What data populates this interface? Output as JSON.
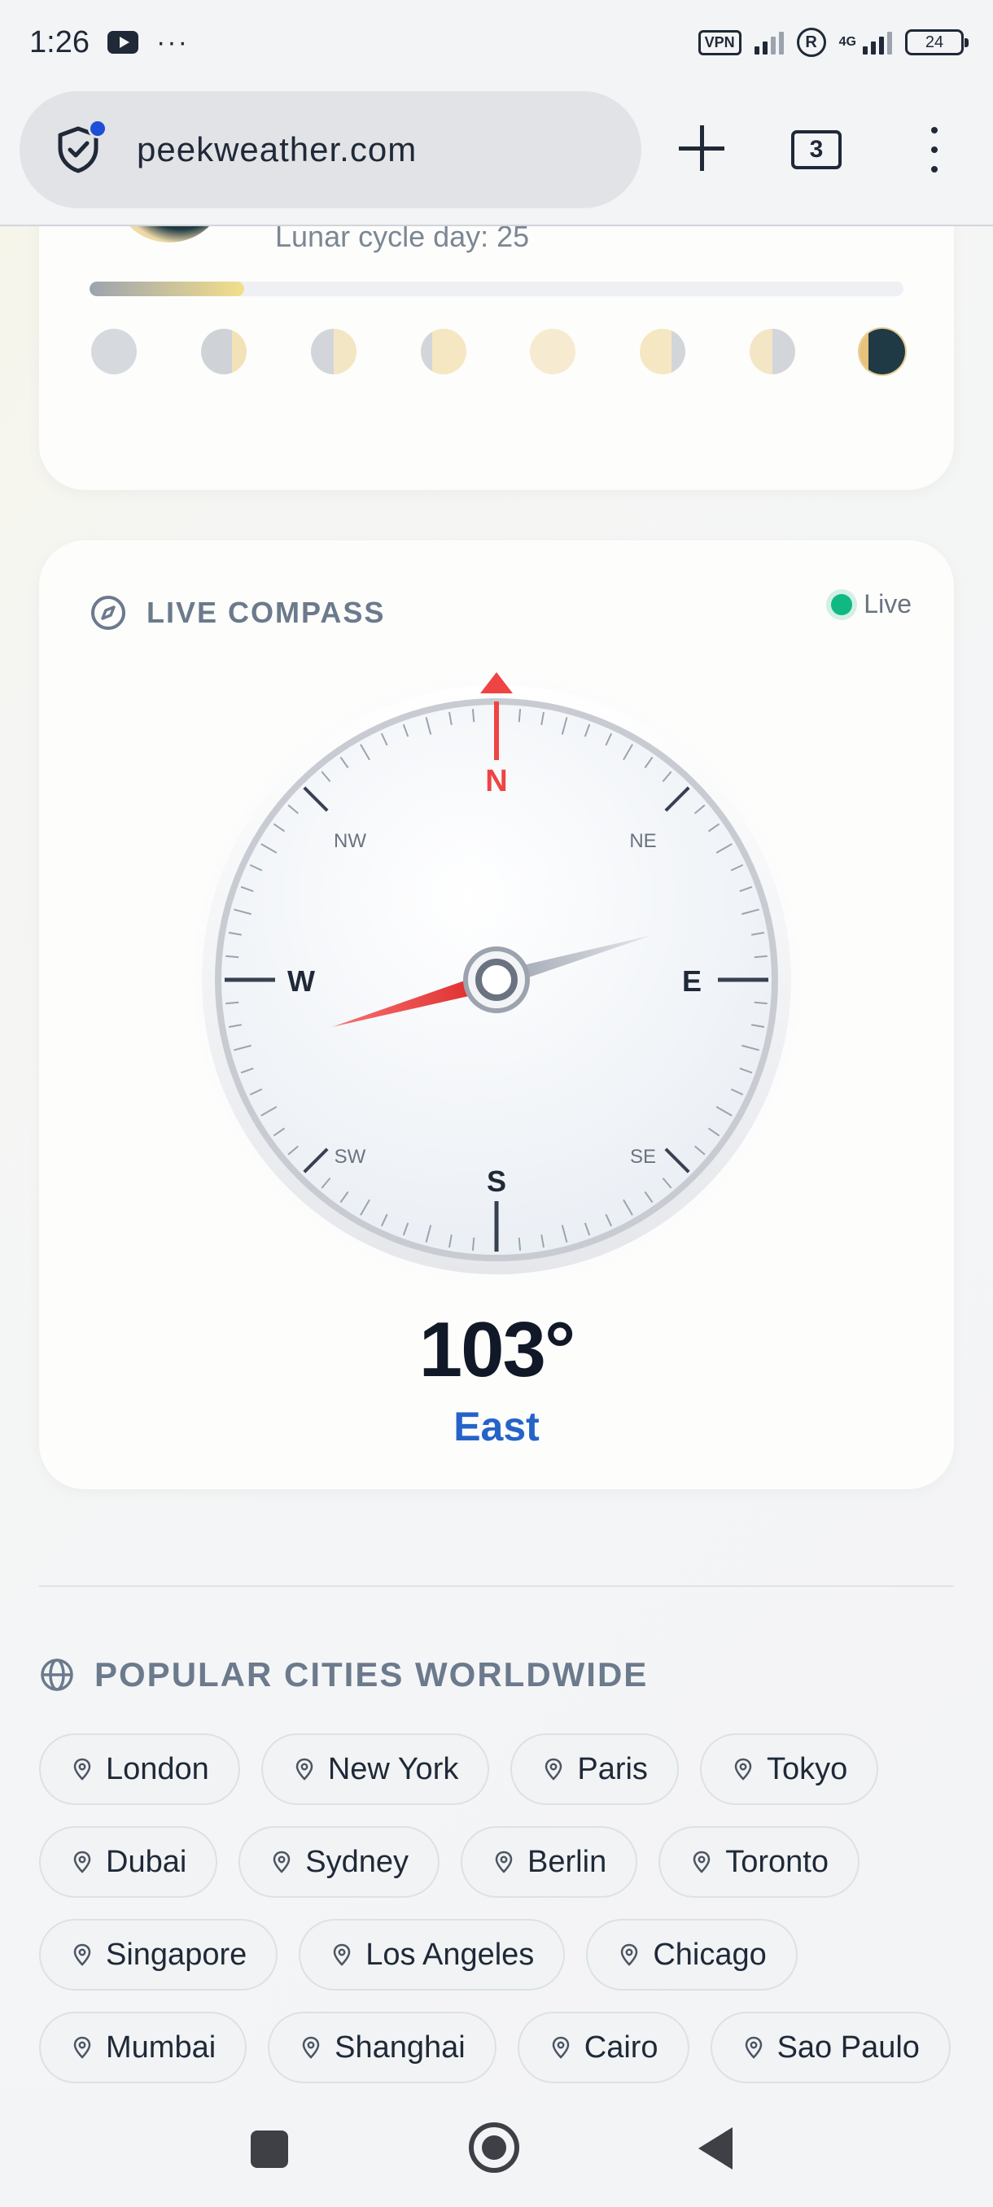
{
  "status_bar": {
    "time": "1:26",
    "dots": "···",
    "vpn": "VPN",
    "r_badge": "R",
    "network": "4G",
    "battery": "24"
  },
  "browser": {
    "url": "peekweather.com",
    "tab_count": "3"
  },
  "lunar": {
    "cycle_text": "Lunar cycle day: 25",
    "progress_fraction": 0.19
  },
  "compass": {
    "title": "LIVE COMPASS",
    "live_label": "Live",
    "heading_deg": 103,
    "heading_text": "103°",
    "direction": "East",
    "cardinals": [
      "N",
      "E",
      "S",
      "W"
    ],
    "intercardinals": [
      "NE",
      "SE",
      "SW",
      "NW"
    ]
  },
  "cities": {
    "title": "POPULAR CITIES WORLDWIDE",
    "rows": [
      [
        "London",
        "New York",
        "Paris",
        "Tokyo"
      ],
      [
        "Dubai",
        "Sydney",
        "Berlin",
        "Toronto"
      ],
      [
        "Singapore",
        "Los Angeles",
        "Chicago"
      ],
      [
        "Mumbai",
        "Shanghai",
        "Cairo",
        "Sao Paulo"
      ]
    ]
  },
  "colors": {
    "accent_blue": "#2563c9",
    "live_green": "#10b981",
    "north_red": "#ef4444"
  }
}
